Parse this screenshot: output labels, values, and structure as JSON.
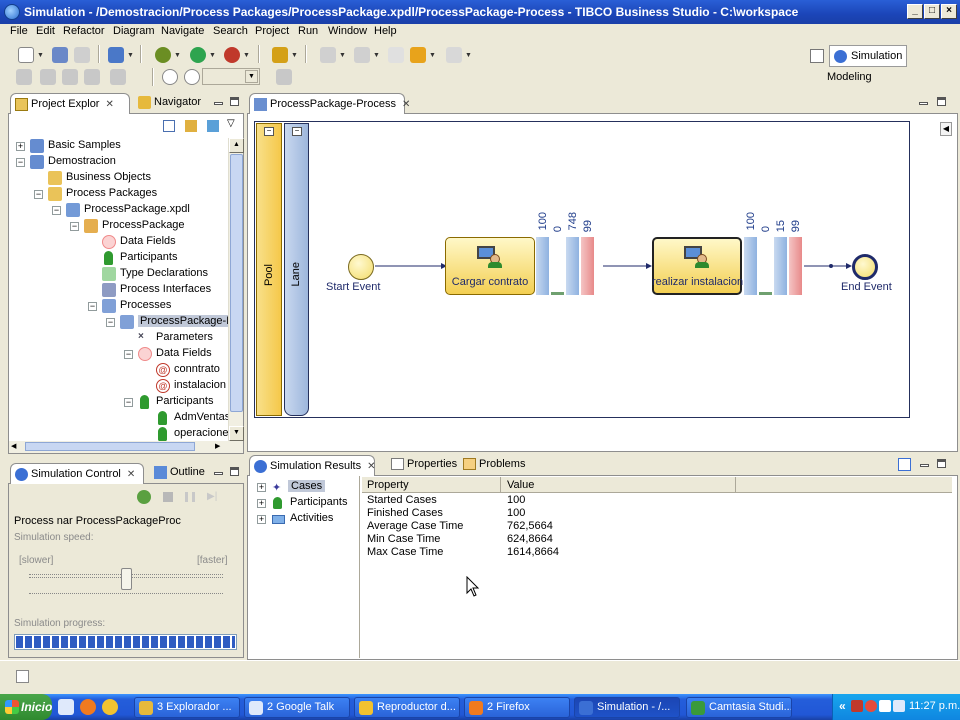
{
  "window": {
    "title": "Simulation - /Demostracion/Process Packages/ProcessPackage.xpdl/ProcessPackage-Process - TIBCO Business Studio - C:\\workspace"
  },
  "menu": [
    "File",
    "Edit",
    "Refactor",
    "Diagram",
    "Navigate",
    "Search",
    "Project",
    "Run",
    "Window",
    "Help"
  ],
  "perspectives": {
    "simulation": "Simulation",
    "modeling": "Modeling"
  },
  "left_top": {
    "tabs": {
      "project_explorer": "Project Explor",
      "navigator": "Navigator"
    },
    "tree": [
      {
        "label": "Basic Samples",
        "level": 0,
        "expander": "+",
        "icon": "project-icon"
      },
      {
        "label": "Demostracion",
        "level": 0,
        "expander": "-",
        "icon": "project-icon"
      },
      {
        "label": "Business Objects",
        "level": 1,
        "expander": "",
        "icon": "business-objects-folder-icon"
      },
      {
        "label": "Process Packages",
        "level": 1,
        "expander": "-",
        "icon": "folder-icon"
      },
      {
        "label": "ProcessPackage.xpdl",
        "level": 2,
        "expander": "-",
        "icon": "xpdl-file-icon"
      },
      {
        "label": "ProcessPackage",
        "level": 3,
        "expander": "-",
        "icon": "package-icon"
      },
      {
        "label": "Data Fields",
        "level": 4,
        "expander": "",
        "icon": "data-fields-icon"
      },
      {
        "label": "Participants",
        "level": 4,
        "expander": "",
        "icon": "participants-icon"
      },
      {
        "label": "Type Declarations",
        "level": 4,
        "expander": "",
        "icon": "type-declarations-icon"
      },
      {
        "label": "Process Interfaces",
        "level": 4,
        "expander": "",
        "icon": "process-interfaces-icon"
      },
      {
        "label": "Processes",
        "level": 4,
        "expander": "-",
        "icon": "processes-icon"
      },
      {
        "label": "ProcessPackage-Pr",
        "level": 5,
        "expander": "-",
        "icon": "process-icon",
        "selected": true
      },
      {
        "label": "Parameters",
        "level": 6,
        "expander": "",
        "icon": "parameters-icon"
      },
      {
        "label": "Data Fields",
        "level": 6,
        "expander": "-",
        "icon": "data-fields-icon"
      },
      {
        "label": "conntrato",
        "level": 7,
        "expander": "",
        "icon": "field-at-icon"
      },
      {
        "label": "instalacion",
        "level": 7,
        "expander": "",
        "icon": "field-at-icon"
      },
      {
        "label": "Participants",
        "level": 6,
        "expander": "-",
        "icon": "participants-icon"
      },
      {
        "label": "AdmVentas",
        "level": 7,
        "expander": "",
        "icon": "participant-icon"
      },
      {
        "label": "operaciones",
        "level": 7,
        "expander": "",
        "icon": "participant-icon"
      }
    ]
  },
  "left_bottom": {
    "tabs": {
      "simulation_control": "Simulation Control",
      "outline": "Outline"
    },
    "process_label": "Process nar ProcessPackageProc",
    "speed_label": "Simulation speed:",
    "slower": "[slower]",
    "faster": "[faster]",
    "progress_label": "Simulation progress:",
    "speed_value": 0.5,
    "progress_value": 1.0
  },
  "editor": {
    "tab": "ProcessPackage-Process",
    "pool": "Pool",
    "lane": "Lane",
    "start_event": "Start Event",
    "end_event": "End Event",
    "tasks": [
      {
        "label": "Cargar contrato",
        "counters": [
          "100",
          "0",
          "748",
          "99"
        ]
      },
      {
        "label": "realizar instalacion",
        "counters": [
          "100",
          "0",
          "15",
          "99"
        ]
      }
    ]
  },
  "bottom": {
    "tabs": {
      "simulation_results": "Simulation Results",
      "properties": "Properties",
      "problems": "Problems"
    },
    "left_tree": [
      "Cases",
      "Participants",
      "Activities"
    ],
    "table": {
      "headers": [
        "Property",
        "Value"
      ],
      "rows": [
        [
          "Started Cases",
          "100"
        ],
        [
          "Finished Cases",
          "100"
        ],
        [
          "Average Case Time",
          "762,5664"
        ],
        [
          "Min Case Time",
          "624,8664"
        ],
        [
          "Max Case Time",
          "1614,8664"
        ]
      ]
    }
  },
  "taskbar": {
    "start": "Inicio",
    "items": [
      "3 Explorador ...",
      "2 Google Talk",
      "Reproductor d...",
      "2 Firefox",
      "Simulation - /...",
      "Camtasia Studi..."
    ],
    "clock": "11:27 p.m."
  },
  "colors": {
    "pool": "#f5c84a",
    "lane": "#9db6dc",
    "task": "#f3cf52",
    "bar_blue": "#8fb2e0",
    "bar_red": "#e88a8a",
    "selection": "#c0c8d8"
  }
}
